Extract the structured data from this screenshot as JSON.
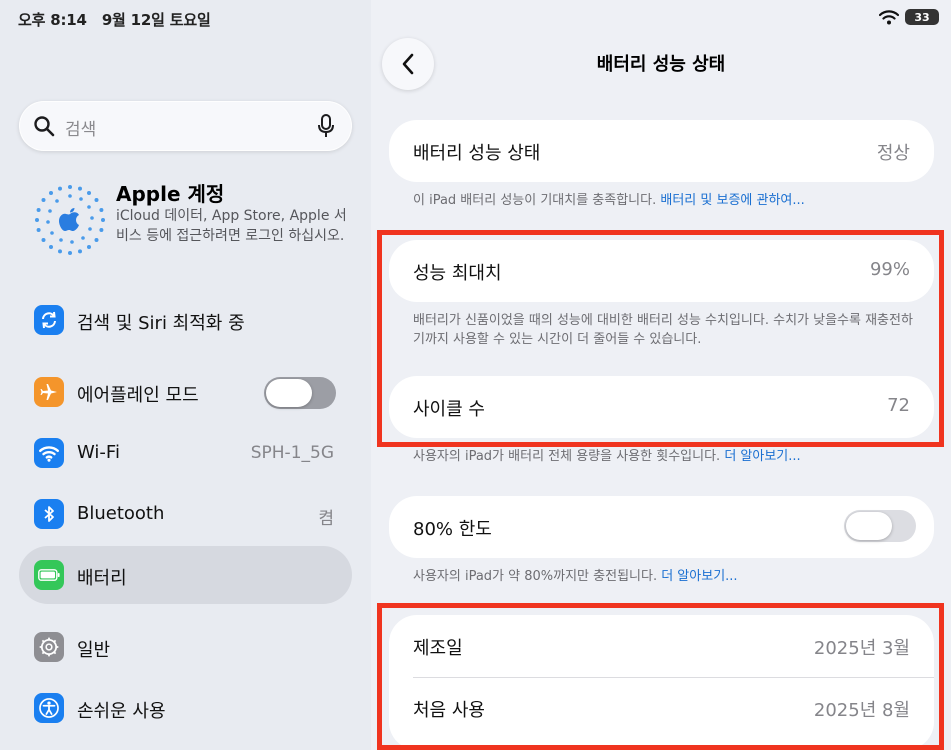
{
  "status_bar": {
    "time": "오후 8:14",
    "date": "9월 12일 토요일",
    "battery_level": "33"
  },
  "sidebar": {
    "search": {
      "placeholder": "검색"
    },
    "account": {
      "name": "Apple 계정",
      "description": "iCloud 데이터, App Store, Apple 서비스 등에 접근하려면 로그인 하십시오."
    },
    "items": [
      {
        "label": "검색 및 Siri 최적화 중",
        "icon": "sync-icon",
        "color": "#1a7ff0"
      },
      {
        "label": "에어플레인 모드",
        "icon": "airplane-icon",
        "color": "#f4952b",
        "toggle": "on"
      },
      {
        "label": "Wi-Fi",
        "value": "SPH-1_5G",
        "icon": "wifi-icon",
        "color": "#1a7ff0"
      },
      {
        "label": "Bluetooth",
        "value": "켬",
        "icon": "bluetooth-icon",
        "color": "#1a7ff0"
      },
      {
        "label": "배터리",
        "icon": "battery-icon",
        "color": "#34c759",
        "selected": true
      },
      {
        "label": "일반",
        "icon": "gear-icon",
        "color": "#8e8e93"
      },
      {
        "label": "손쉬운 사용",
        "icon": "accessibility-icon",
        "color": "#1a7ff0"
      }
    ]
  },
  "detail": {
    "title": "배터리 성능 상태",
    "health": {
      "label": "배터리 성능 상태",
      "value": "정상"
    },
    "health_note": {
      "text": "이 iPad 배터리 성능이 기대치를 충족합니다. ",
      "link": "배터리 및 보증에 관하여..."
    },
    "max_capacity": {
      "label": "성능 최대치",
      "value": "99%"
    },
    "capacity_note": "배터리가 신품이었을 때의 성능에 대비한 배터리 성능 수치입니다. 수치가 낮을수록 재충전하기까지 사용할 수 있는 시간이 더 줄어들 수 있습니다.",
    "cycle_count": {
      "label": "사이클 수",
      "value": "72"
    },
    "cycle_note": {
      "text": "사용자의 iPad가 배터리 전체 용량을 사용한 횟수입니다. ",
      "link": "더 알아보기..."
    },
    "limit": {
      "label": "80% 한도",
      "toggle": "off"
    },
    "limit_note": {
      "text": "사용자의 iPad가 약 80%까지만 충전됩니다. ",
      "link": "더 알아보기..."
    },
    "manufactured": {
      "label": "제조일",
      "value": "2025년 3월"
    },
    "first_use": {
      "label": "처음 사용",
      "value": "2025년 8월"
    }
  },
  "colors": {
    "highlight": "#f0341f",
    "link": "#1a6fd1"
  }
}
